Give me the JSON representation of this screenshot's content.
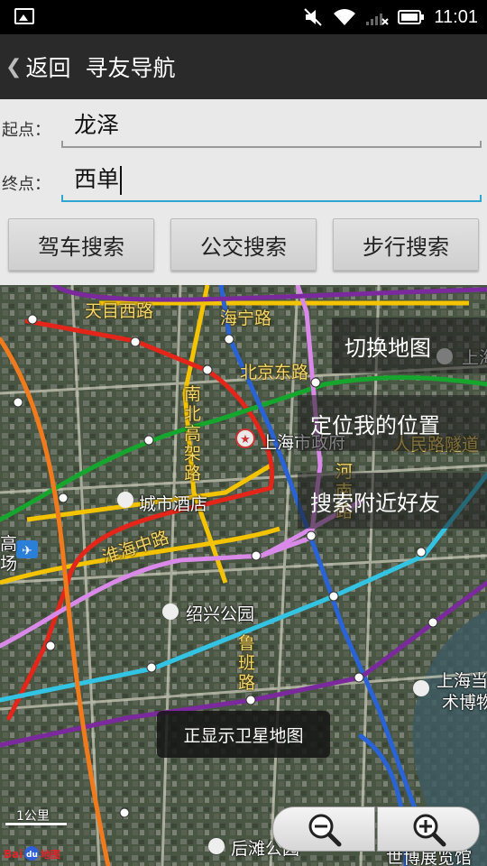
{
  "status_bar": {
    "time": "11:01",
    "icons": [
      "image-notification-icon",
      "mute-icon",
      "wifi-icon",
      "signal-icon",
      "battery-icon"
    ]
  },
  "title_bar": {
    "back_label": "返回",
    "title": "寻友导航"
  },
  "form": {
    "start_label": "起点：",
    "start_value": "龙泽",
    "end_label": "终点：",
    "end_value": "西单"
  },
  "buttons": {
    "drive": "驾车搜索",
    "transit": "公交搜索",
    "walk": "步行搜索"
  },
  "map": {
    "labels": {
      "tianmu_road": "天目西路",
      "haining_road": "海宁路",
      "beijing_east_road": "北京东路",
      "nanbei_elevated": "南北高架路",
      "city_government": "上海市政府",
      "henan_road": "河南路",
      "renmin_tunnel": "人民路隧道",
      "city_hotel": "城市酒店",
      "huaihai_road": "淮海中路",
      "shaoxing_park": "绍兴公园",
      "luban_road": "鲁班路",
      "shanghai_top_right": "上海",
      "museum_line1": "上海当",
      "museum_line2": "术博物",
      "left_edge_line1": "高",
      "left_edge_line2": "场",
      "bund_park": "后滩公园",
      "expo_hall": "世博展览馆"
    },
    "menu": {
      "switch_map": "切换地图",
      "locate_me": "定位我的位置",
      "search_friends": "搜索附近好友"
    },
    "toast": "正显示卫星地图",
    "scale": "1公里",
    "logo": "Baidu地图"
  },
  "colors": {
    "title_bar": "#2a2a2a",
    "form_bg": "#e9e9e9",
    "active_underline": "#2fa6d0",
    "metro_red": "#e32619",
    "metro_green": "#16a62e",
    "metro_blue": "#2a63d6",
    "metro_purple": "#7a2a9c",
    "metro_cyan": "#33c4e3",
    "metro_pink": "#d98ae8",
    "metro_orange": "#f07a1c",
    "metro_yellow": "#f5c400"
  }
}
